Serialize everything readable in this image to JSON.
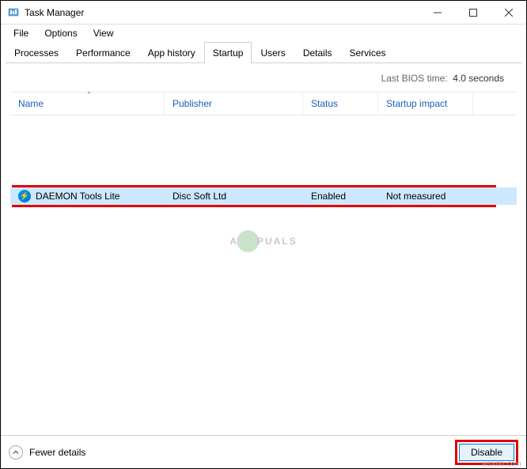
{
  "window": {
    "title": "Task Manager"
  },
  "menu": {
    "file": "File",
    "options": "Options",
    "view": "View"
  },
  "tabs": {
    "processes": "Processes",
    "performance": "Performance",
    "app_history": "App history",
    "startup": "Startup",
    "users": "Users",
    "details": "Details",
    "services": "Services"
  },
  "bios": {
    "label": "Last BIOS time:",
    "value": "4.0 seconds"
  },
  "columns": {
    "name": "Name",
    "publisher": "Publisher",
    "status": "Status",
    "impact": "Startup impact"
  },
  "rows": [
    {
      "name": "DAEMON Tools Lite",
      "publisher": "Disc Soft Ltd",
      "status": "Enabled",
      "impact": "Not measured",
      "icon": "daemon-icon"
    }
  ],
  "footer": {
    "fewer_details": "Fewer details",
    "disable": "Disable"
  },
  "watermark": {
    "left": "A",
    "right": "PUALS"
  },
  "attribution": "wsxdn.com"
}
